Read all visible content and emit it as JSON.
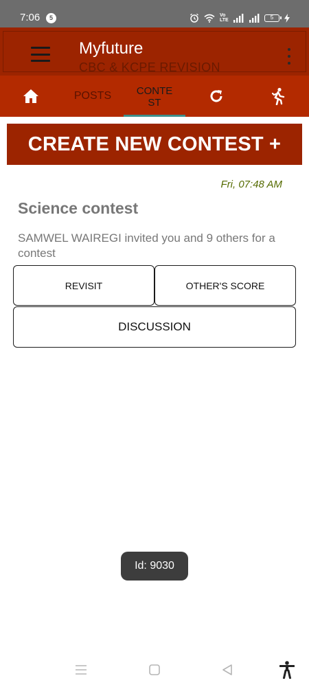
{
  "status_bar": {
    "time": "7:06",
    "notification_count": "5",
    "volte_label": "Vo LTE",
    "battery_level": "5"
  },
  "app_bar": {
    "title": "Myfuture",
    "subtitle": "CBC & KCPE REVISION"
  },
  "tabs": {
    "posts": "POSTS",
    "contest": "CONTEST",
    "active": "contest"
  },
  "create_button": {
    "label": "CREATE NEW CONTEST +"
  },
  "contest": {
    "timestamp": "Fri, 07:48 AM",
    "title": "Science contest",
    "description": "SAMWEL WAIREGI invited you and 9 others for a contest",
    "revisit_label": "REVISIT",
    "others_score_label": "OTHER'S SCORE",
    "discussion_label": "DISCUSSION"
  },
  "toast": {
    "text": "Id: 9030"
  },
  "colors": {
    "primary": "#9c2400",
    "tab_bar": "#b32a00",
    "tab_indicator": "#3f8f8a",
    "timestamp": "#556b00",
    "status_bar": "#6d6d6d"
  },
  "icons": {
    "home": "home-icon",
    "refresh": "refresh-icon",
    "run": "running-person-icon",
    "menu": "hamburger-menu-icon",
    "overflow": "overflow-menu-icon",
    "nav_menu": "recent-apps-icon",
    "nav_home": "home-square-icon",
    "nav_back": "back-triangle-icon",
    "accessibility": "accessibility-icon"
  }
}
